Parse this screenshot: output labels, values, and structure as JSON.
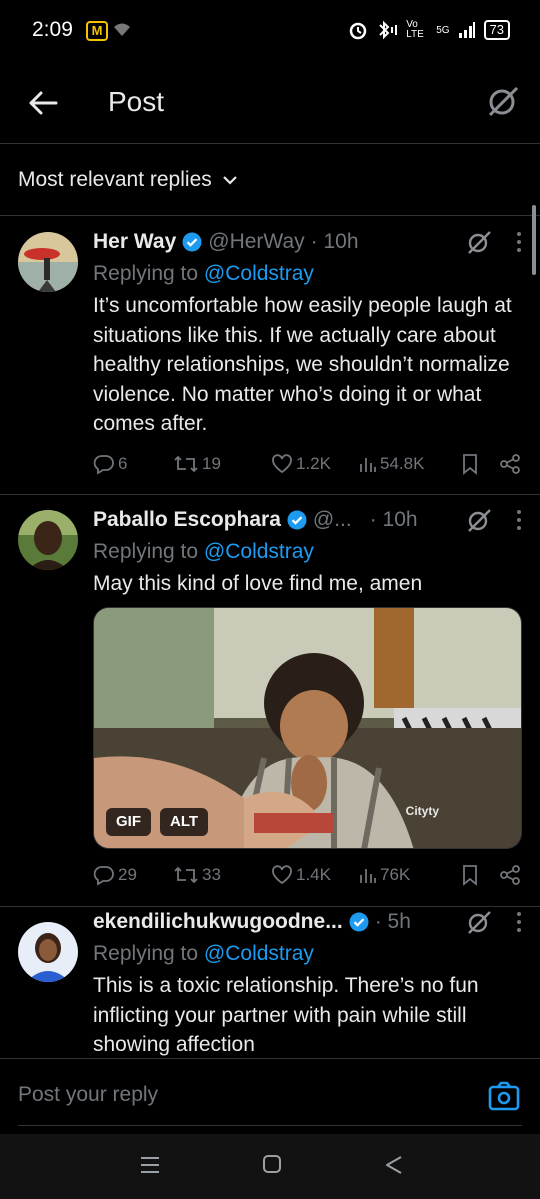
{
  "status_bar": {
    "time": "2:09",
    "network": "5G",
    "volte": "Vo LTE",
    "battery": "73"
  },
  "header": {
    "title": "Post"
  },
  "filter": {
    "label": "Most relevant replies"
  },
  "tweets": [
    {
      "name": "Her Way",
      "handle": "@HerWay",
      "time": "· 10h",
      "replying_prefix": "Replying to ",
      "replying_to": "@Coldstray",
      "text": "It’s uncomfortable how easily people laugh at situations like this. If we actually care about healthy relationships, we shouldn’t normalize violence. No matter who’s doing it or what comes after.",
      "replies": "6",
      "reposts": "19",
      "likes": "1.2K",
      "views": "54.8K"
    },
    {
      "name": "Paballo Escophara",
      "handle": "@...",
      "time": "· 10h",
      "replying_prefix": "Replying to ",
      "replying_to": "@Coldstray",
      "text": "May this kind of love find me, amen",
      "media_badges": [
        "GIF",
        "ALT"
      ],
      "media_watermark": "Cityty",
      "replies": "29",
      "reposts": "33",
      "likes": "1.4K",
      "views": "76K"
    },
    {
      "name": "ekendilichukwugoodne...",
      "handle": "",
      "time": "· 5h",
      "replying_prefix": "Replying to ",
      "replying_to": "@Coldstray",
      "text": "This is a toxic relationship. There’s no fun inflicting your partner with pain while still showing affection"
    }
  ],
  "reply_bar": {
    "placeholder": "Post your reply"
  },
  "colors": {
    "accent": "#1d9bf0",
    "muted": "#71767b",
    "background": "#000000",
    "divider": "#2f3336"
  }
}
